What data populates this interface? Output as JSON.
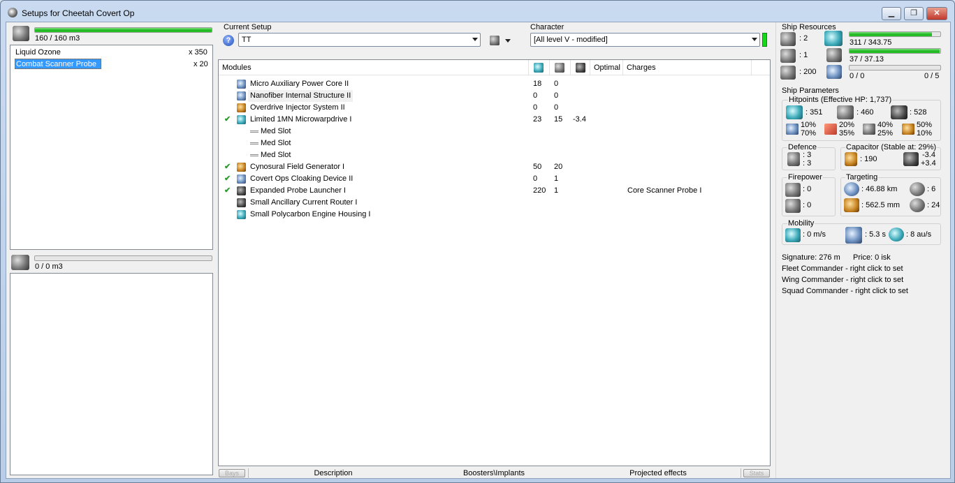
{
  "window": {
    "title": "Setups for Cheetah Covert Op",
    "minimize": "▁",
    "restore": "❐",
    "close": "✕"
  },
  "cargo": {
    "capacity": "160 / 160 m3",
    "fill": 1.0,
    "items": [
      {
        "name": "Liquid Ozone",
        "qty": "x 350",
        "selected": false
      },
      {
        "name": "Combat Scanner Probe I",
        "qty": "x 20",
        "selected": true
      }
    ]
  },
  "drones": {
    "capacity": "0 / 0 m3",
    "fill": 0.0
  },
  "current_setup": {
    "label": "Current Setup",
    "value": "TT",
    "help_icon": "help-icon"
  },
  "character": {
    "label": "Character",
    "value": "[All level V - modified]"
  },
  "modules_table": {
    "headers": {
      "modules": "Modules",
      "cpu": "cpu-icon",
      "power": "powergrid-icon",
      "cap": "capacitor-icon",
      "optimal": "Optimal",
      "charges": "Charges"
    },
    "rows": [
      {
        "check": "",
        "name": "Micro Auxiliary Power Core II",
        "c1": "18",
        "c2": "0",
        "c3": "",
        "charges": "",
        "icon": "ic-blue"
      },
      {
        "check": "",
        "name": "Nanofiber Internal Structure II",
        "c1": "0",
        "c2": "0",
        "c3": "",
        "charges": "",
        "icon": "ic-blue"
      },
      {
        "check": "",
        "name": "Overdrive Injector System II",
        "c1": "0",
        "c2": "0",
        "c3": "",
        "charges": "",
        "icon": "ic-amber"
      },
      {
        "check": "✔",
        "name": "Limited 1MN Microwarpdrive I",
        "c1": "23",
        "c2": "15",
        "c3": "-3.4",
        "charges": "",
        "icon": "ic-teal"
      },
      {
        "check": "",
        "name": "Med Slot",
        "c1": "",
        "c2": "",
        "c3": "",
        "charges": "",
        "icon": "slot"
      },
      {
        "check": "",
        "name": "Med Slot",
        "c1": "",
        "c2": "",
        "c3": "",
        "charges": "",
        "icon": "slot"
      },
      {
        "check": "",
        "name": "Med Slot",
        "c1": "",
        "c2": "",
        "c3": "",
        "charges": "",
        "icon": "slot"
      },
      {
        "check": "✔",
        "name": "Cynosural Field Generator I",
        "c1": "50",
        "c2": "20",
        "c3": "",
        "charges": "",
        "icon": "ic-amber"
      },
      {
        "check": "✔",
        "name": "Covert Ops Cloaking Device II",
        "c1": "0",
        "c2": "1",
        "c3": "",
        "charges": "",
        "icon": "ic-blue"
      },
      {
        "check": "✔",
        "name": "Expanded Probe Launcher I",
        "c1": "220",
        "c2": "1",
        "c3": "",
        "charges": "Core Scanner Probe I",
        "icon": "ic-dark"
      },
      {
        "check": "",
        "name": "Small Ancillary Current Router I",
        "c1": "",
        "c2": "",
        "c3": "",
        "charges": "",
        "icon": "ic-dark"
      },
      {
        "check": "",
        "name": "Small Polycarbon Engine Housing I",
        "c1": "",
        "c2": "",
        "c3": "",
        "charges": "",
        "icon": "ic-teal"
      }
    ]
  },
  "bottom_tabs": {
    "prev": "Bays",
    "description": "Description",
    "boosters": "Boosters\\Implants",
    "projected": "Projected effects",
    "next": "Stats"
  },
  "ship_resources": {
    "label": "Ship Resources",
    "hardpoints": [
      {
        "icon": "turret-hardpoint-icon",
        "value": ": 2"
      },
      {
        "icon": "launcher-hardpoint-icon",
        "value": ": 1"
      },
      {
        "icon": "calibration-icon",
        "value": ": 200"
      }
    ],
    "cpu": {
      "text": "311 / 343.75",
      "fill": 0.905
    },
    "power": {
      "text": "37 / 37.13",
      "fill": 0.996
    },
    "drone_bw": {
      "text": "0 / 0",
      "fill": 0.0
    },
    "drone_count": "0 / 5"
  },
  "ship_parameters": {
    "label": "Ship Parameters",
    "hitpoints": {
      "label": "Hitpoints (Effective HP: 1,737)",
      "shield": ": 351",
      "armor": ": 460",
      "hull": ": 528",
      "resists": [
        {
          "icon": "em-resist-icon",
          "top": "10%",
          "bottom": "70%"
        },
        {
          "icon": "thermal-resist-icon",
          "top": "20%",
          "bottom": "35%"
        },
        {
          "icon": "kinetic-resist-icon",
          "top": "40%",
          "bottom": "25%"
        },
        {
          "icon": "explosive-resist-icon",
          "top": "50%",
          "bottom": "10%"
        }
      ]
    },
    "defence": {
      "label": "Defence",
      "top": ": 3",
      "bottom": ": 3"
    },
    "capacitor": {
      "label": "Capacitor (Stable at: 29%)",
      "amount": ": 190",
      "top": "-3.4",
      "bottom": "+3.4"
    },
    "firepower": {
      "label": "Firepower",
      "top": ": 0",
      "bottom": ": 0"
    },
    "targeting": {
      "label": "Targeting",
      "range": ": 46.88 km",
      "targets": ": 6",
      "resolution": ": 562.5 mm",
      "sensor": ": 24"
    },
    "mobility": {
      "label": "Mobility",
      "speed": ": 0 m/s",
      "align": ": 5.3 s",
      "warp": ": 8 au/s"
    }
  },
  "footer_info": {
    "signature": "Signature: 276 m",
    "price": "Price: 0 isk",
    "fleet": "Fleet Commander - right click to set",
    "wing": "Wing Commander - right click to set",
    "squad": "Squad Commander - right click to set"
  }
}
